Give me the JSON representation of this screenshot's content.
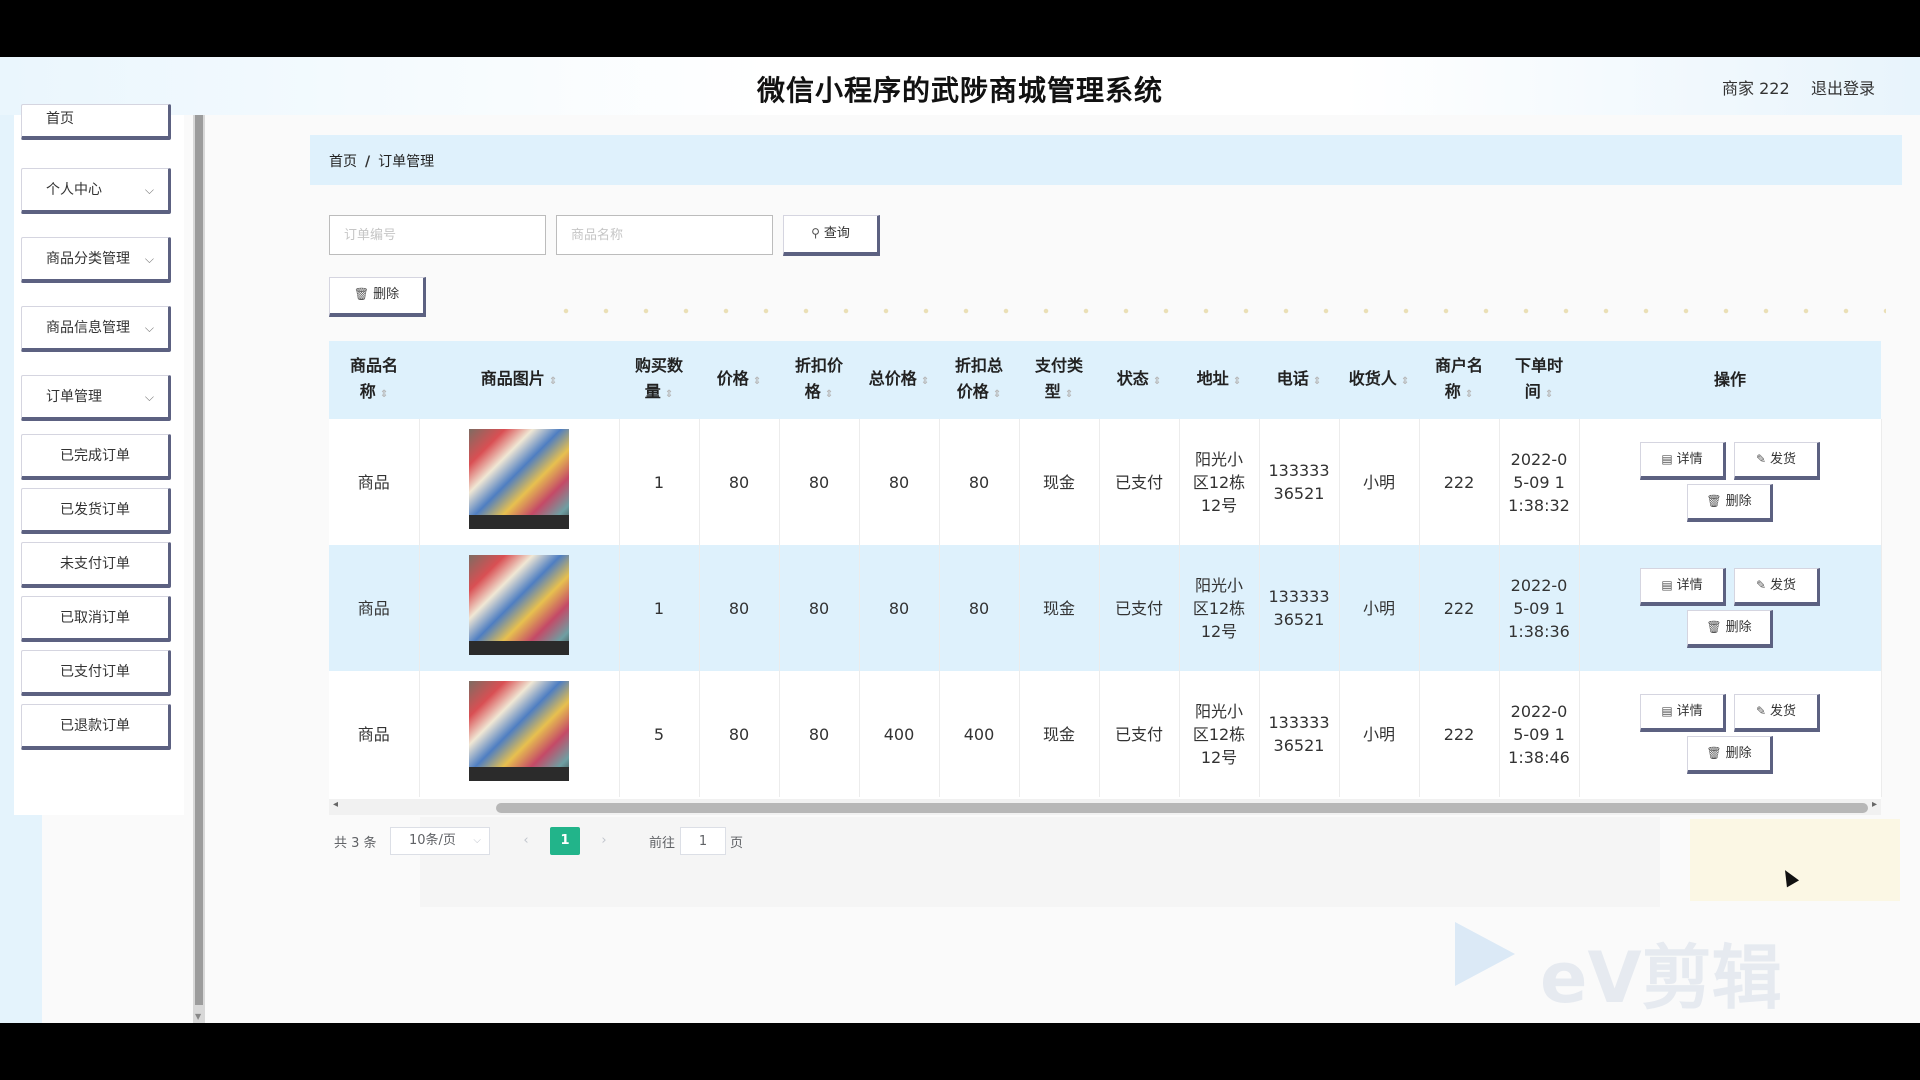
{
  "header": {
    "title": "微信小程序的武陟商城管理系统",
    "user": "商家 222",
    "logout": "退出登录"
  },
  "sidebar": {
    "items": [
      {
        "label": "首页",
        "chevron": false
      },
      {
        "label": "个人中心",
        "chevron": true
      },
      {
        "label": "商品分类管理",
        "chevron": true
      },
      {
        "label": "商品信息管理",
        "chevron": true
      },
      {
        "label": "订单管理",
        "chevron": true
      }
    ],
    "sub_items": [
      "已完成订单",
      "已发货订单",
      "未支付订单",
      "已取消订单",
      "已支付订单",
      "已退款订单"
    ]
  },
  "breadcrumb": {
    "home": "首页",
    "sep": "/",
    "current": "订单管理"
  },
  "search": {
    "order_no_placeholder": "订单编号",
    "product_name_placeholder": "商品名称",
    "query_label": "查询"
  },
  "toolbar": {
    "delete_label": "删除"
  },
  "table": {
    "headers": [
      {
        "line1": "商品名",
        "line2": "称"
      },
      {
        "line1": "商品图片",
        "line2": ""
      },
      {
        "line1": "购买数",
        "line2": "量"
      },
      {
        "line1": "价格",
        "line2": ""
      },
      {
        "line1": "折扣价",
        "line2": "格"
      },
      {
        "line1": "总价格",
        "line2": ""
      },
      {
        "line1": "折扣总",
        "line2": "价格"
      },
      {
        "line1": "支付类",
        "line2": "型"
      },
      {
        "line1": "状态",
        "line2": ""
      },
      {
        "line1": "地址",
        "line2": ""
      },
      {
        "line1": "电话",
        "line2": ""
      },
      {
        "line1": "收货人",
        "line2": ""
      },
      {
        "line1": "商户名",
        "line2": "称"
      },
      {
        "line1": "下单时",
        "line2": "间"
      },
      {
        "line1": "操作",
        "line2": ""
      }
    ],
    "rows": [
      {
        "name": "商品",
        "qty": "1",
        "price": "80",
        "discount_price": "80",
        "total": "80",
        "discount_total": "80",
        "pay_type": "现金",
        "status": "已支付",
        "address": [
          "阳光小",
          "区12栋",
          "12号"
        ],
        "phone": [
          "133333",
          "36521"
        ],
        "receiver": "小明",
        "merchant": "222",
        "time": [
          "2022-0",
          "5-09 1",
          "1:38:32"
        ]
      },
      {
        "name": "商品",
        "qty": "1",
        "price": "80",
        "discount_price": "80",
        "total": "80",
        "discount_total": "80",
        "pay_type": "现金",
        "status": "已支付",
        "address": [
          "阳光小",
          "区12栋",
          "12号"
        ],
        "phone": [
          "133333",
          "36521"
        ],
        "receiver": "小明",
        "merchant": "222",
        "time": [
          "2022-0",
          "5-09 1",
          "1:38:36"
        ]
      },
      {
        "name": "商品",
        "qty": "5",
        "price": "80",
        "discount_price": "80",
        "total": "400",
        "discount_total": "400",
        "pay_type": "现金",
        "status": "已支付",
        "address": [
          "阳光小",
          "区12栋",
          "12号"
        ],
        "phone": [
          "133333",
          "36521"
        ],
        "receiver": "小明",
        "merchant": "222",
        "time": [
          "2022-0",
          "5-09 1",
          "1:38:46"
        ]
      }
    ],
    "actions": {
      "detail": "详情",
      "ship": "发货",
      "delete": "删除"
    }
  },
  "pagination": {
    "total": "共 3 条",
    "page_size": "10条/页",
    "current": "1",
    "goto": "前往",
    "goto_value": "1",
    "page_suffix": "页"
  },
  "watermark": "eV剪辑",
  "icons": {
    "search": "search-icon",
    "trash": "trash-icon",
    "doc": "document-icon",
    "edit": "edit-icon",
    "chevron": "chevron-down-icon"
  },
  "colors": {
    "accent_border": "#5c6181",
    "header_bg": "#def1fc",
    "page_active": "#22b48a"
  }
}
